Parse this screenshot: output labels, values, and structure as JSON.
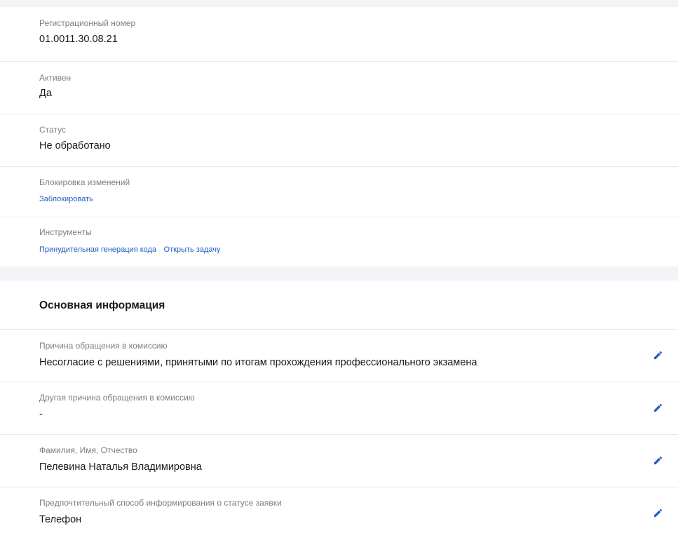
{
  "info_rows": [
    {
      "label": "Регистрационный номер",
      "value": "01.0011.30.08.21"
    },
    {
      "label": "Активен",
      "value": "Да"
    },
    {
      "label": "Статус",
      "value": "Не обработано"
    }
  ],
  "lock": {
    "label": "Блокировка изменений",
    "link": "Заблокировать"
  },
  "tools": {
    "label": "Инструменты",
    "links": [
      "Принудительная генерация кода",
      "Открыть задачу"
    ]
  },
  "main_section": {
    "title": "Основная информация",
    "fields": [
      {
        "label": "Причина обращения в комиссию",
        "value": "Несогласие с решениями, принятыми по итогам прохождения профессионального экзамена"
      },
      {
        "label": "Другая причина обращения в комиссию",
        "value": "-"
      },
      {
        "label": "Фамилия, Имя, Отчество",
        "value": "Пелевина Наталья Владимировна"
      },
      {
        "label": "Предпочтительный способ информирования о статусе заявки",
        "value": "Телефон"
      }
    ],
    "edit_icon": "pencil-icon"
  },
  "colors": {
    "link": "#1f5fbf",
    "label": "#7a7f87",
    "edit_icon": "#1f5fbf"
  }
}
